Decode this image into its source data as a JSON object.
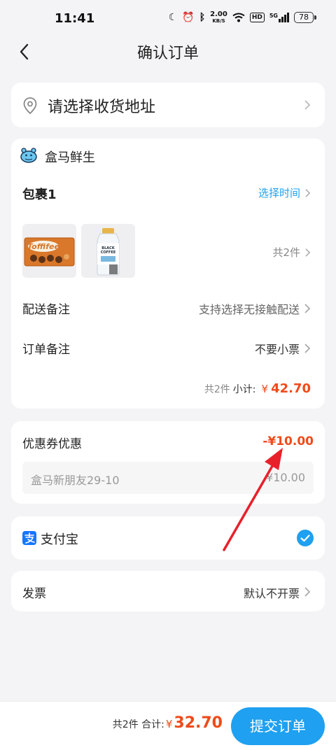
{
  "status_bar": {
    "time": "11:41",
    "net_speed_value": "2.00",
    "net_speed_unit": "KB/S",
    "hd": "HD",
    "signal": "5G",
    "battery": "78"
  },
  "header": {
    "title": "确认订单"
  },
  "address": {
    "placeholder": "请选择收货地址"
  },
  "store": {
    "name": "盒马鲜生",
    "package": {
      "title": "包裹1",
      "time_label": "选择时间",
      "item_count": "共2件",
      "products": [
        {
          "name": "Toffifee",
          "icon": "toffifee-box"
        },
        {
          "name": "BLACK COFFEE",
          "icon": "coffee-bottle"
        }
      ]
    },
    "delivery_note": {
      "label": "配送备注",
      "value": "支持选择无接触配送"
    },
    "order_note": {
      "label": "订单备注",
      "value": "不要小票"
    },
    "subtotal": {
      "count": "共2件",
      "label": "小计:",
      "currency": "¥",
      "amount": "42.70"
    }
  },
  "coupon": {
    "label": "优惠券优惠",
    "discount": "-¥10.00",
    "item_name": "盒马新朋友29-10",
    "item_value": "¥10.00"
  },
  "payment": {
    "method": "支付宝",
    "selected": true
  },
  "invoice": {
    "label": "发票",
    "value": "默认不开票"
  },
  "footer": {
    "count": "共2件 合计:",
    "currency": "¥",
    "total": "32.70",
    "submit": "提交订单"
  },
  "colors": {
    "accent": "#1fa0f0",
    "price": "#f04a1a",
    "annotation": "#e8202a"
  }
}
